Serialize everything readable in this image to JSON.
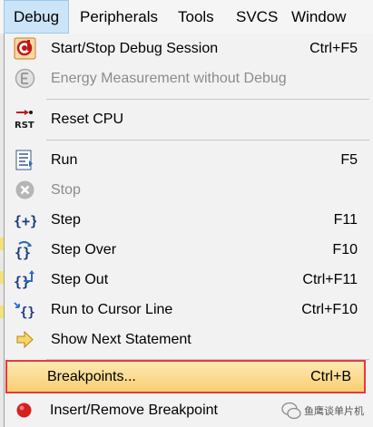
{
  "menubar": {
    "items": [
      {
        "label": "Debug"
      },
      {
        "label": "Peripherals"
      },
      {
        "label": "Tools"
      },
      {
        "label": "SVCS"
      },
      {
        "label": "Window"
      }
    ]
  },
  "menu": {
    "items": [
      {
        "label": "Start/Stop Debug Session",
        "shortcut": "Ctrl+F5",
        "icon": "debug-session-icon"
      },
      {
        "label": "Energy Measurement without Debug",
        "shortcut": "",
        "icon": "energy-measurement-icon"
      },
      {
        "label": "Reset CPU",
        "shortcut": "",
        "icon": "reset-cpu-icon",
        "icon_text": "RST"
      },
      {
        "label": "Run",
        "shortcut": "F5",
        "icon": "run-icon"
      },
      {
        "label": "Stop",
        "shortcut": "",
        "icon": "stop-icon"
      },
      {
        "label": "Step",
        "shortcut": "F11",
        "icon": "step-icon",
        "icon_text": "{+}"
      },
      {
        "label": "Step Over",
        "shortcut": "F10",
        "icon": "step-over-icon",
        "icon_text": "{}"
      },
      {
        "label": "Step Out",
        "shortcut": "Ctrl+F11",
        "icon": "step-out-icon",
        "icon_text": "{}"
      },
      {
        "label": "Run to Cursor Line",
        "shortcut": "Ctrl+F10",
        "icon": "run-to-cursor-icon",
        "icon_text": "{}"
      },
      {
        "label": "Show Next Statement",
        "shortcut": "",
        "icon": "show-next-statement-icon"
      },
      {
        "label": "Breakpoints...",
        "shortcut": "Ctrl+B",
        "icon": ""
      },
      {
        "label": "Insert/Remove Breakpoint",
        "shortcut": "",
        "icon": "breakpoint-icon"
      }
    ]
  },
  "watermark": {
    "text": "鱼鹰谈单片机"
  },
  "colors": {
    "highlight_border": "#e8393d",
    "highlight_fill": "#f8cf72",
    "menubar_active": "#cce4f7",
    "disabled_text": "#8c8c8c"
  }
}
